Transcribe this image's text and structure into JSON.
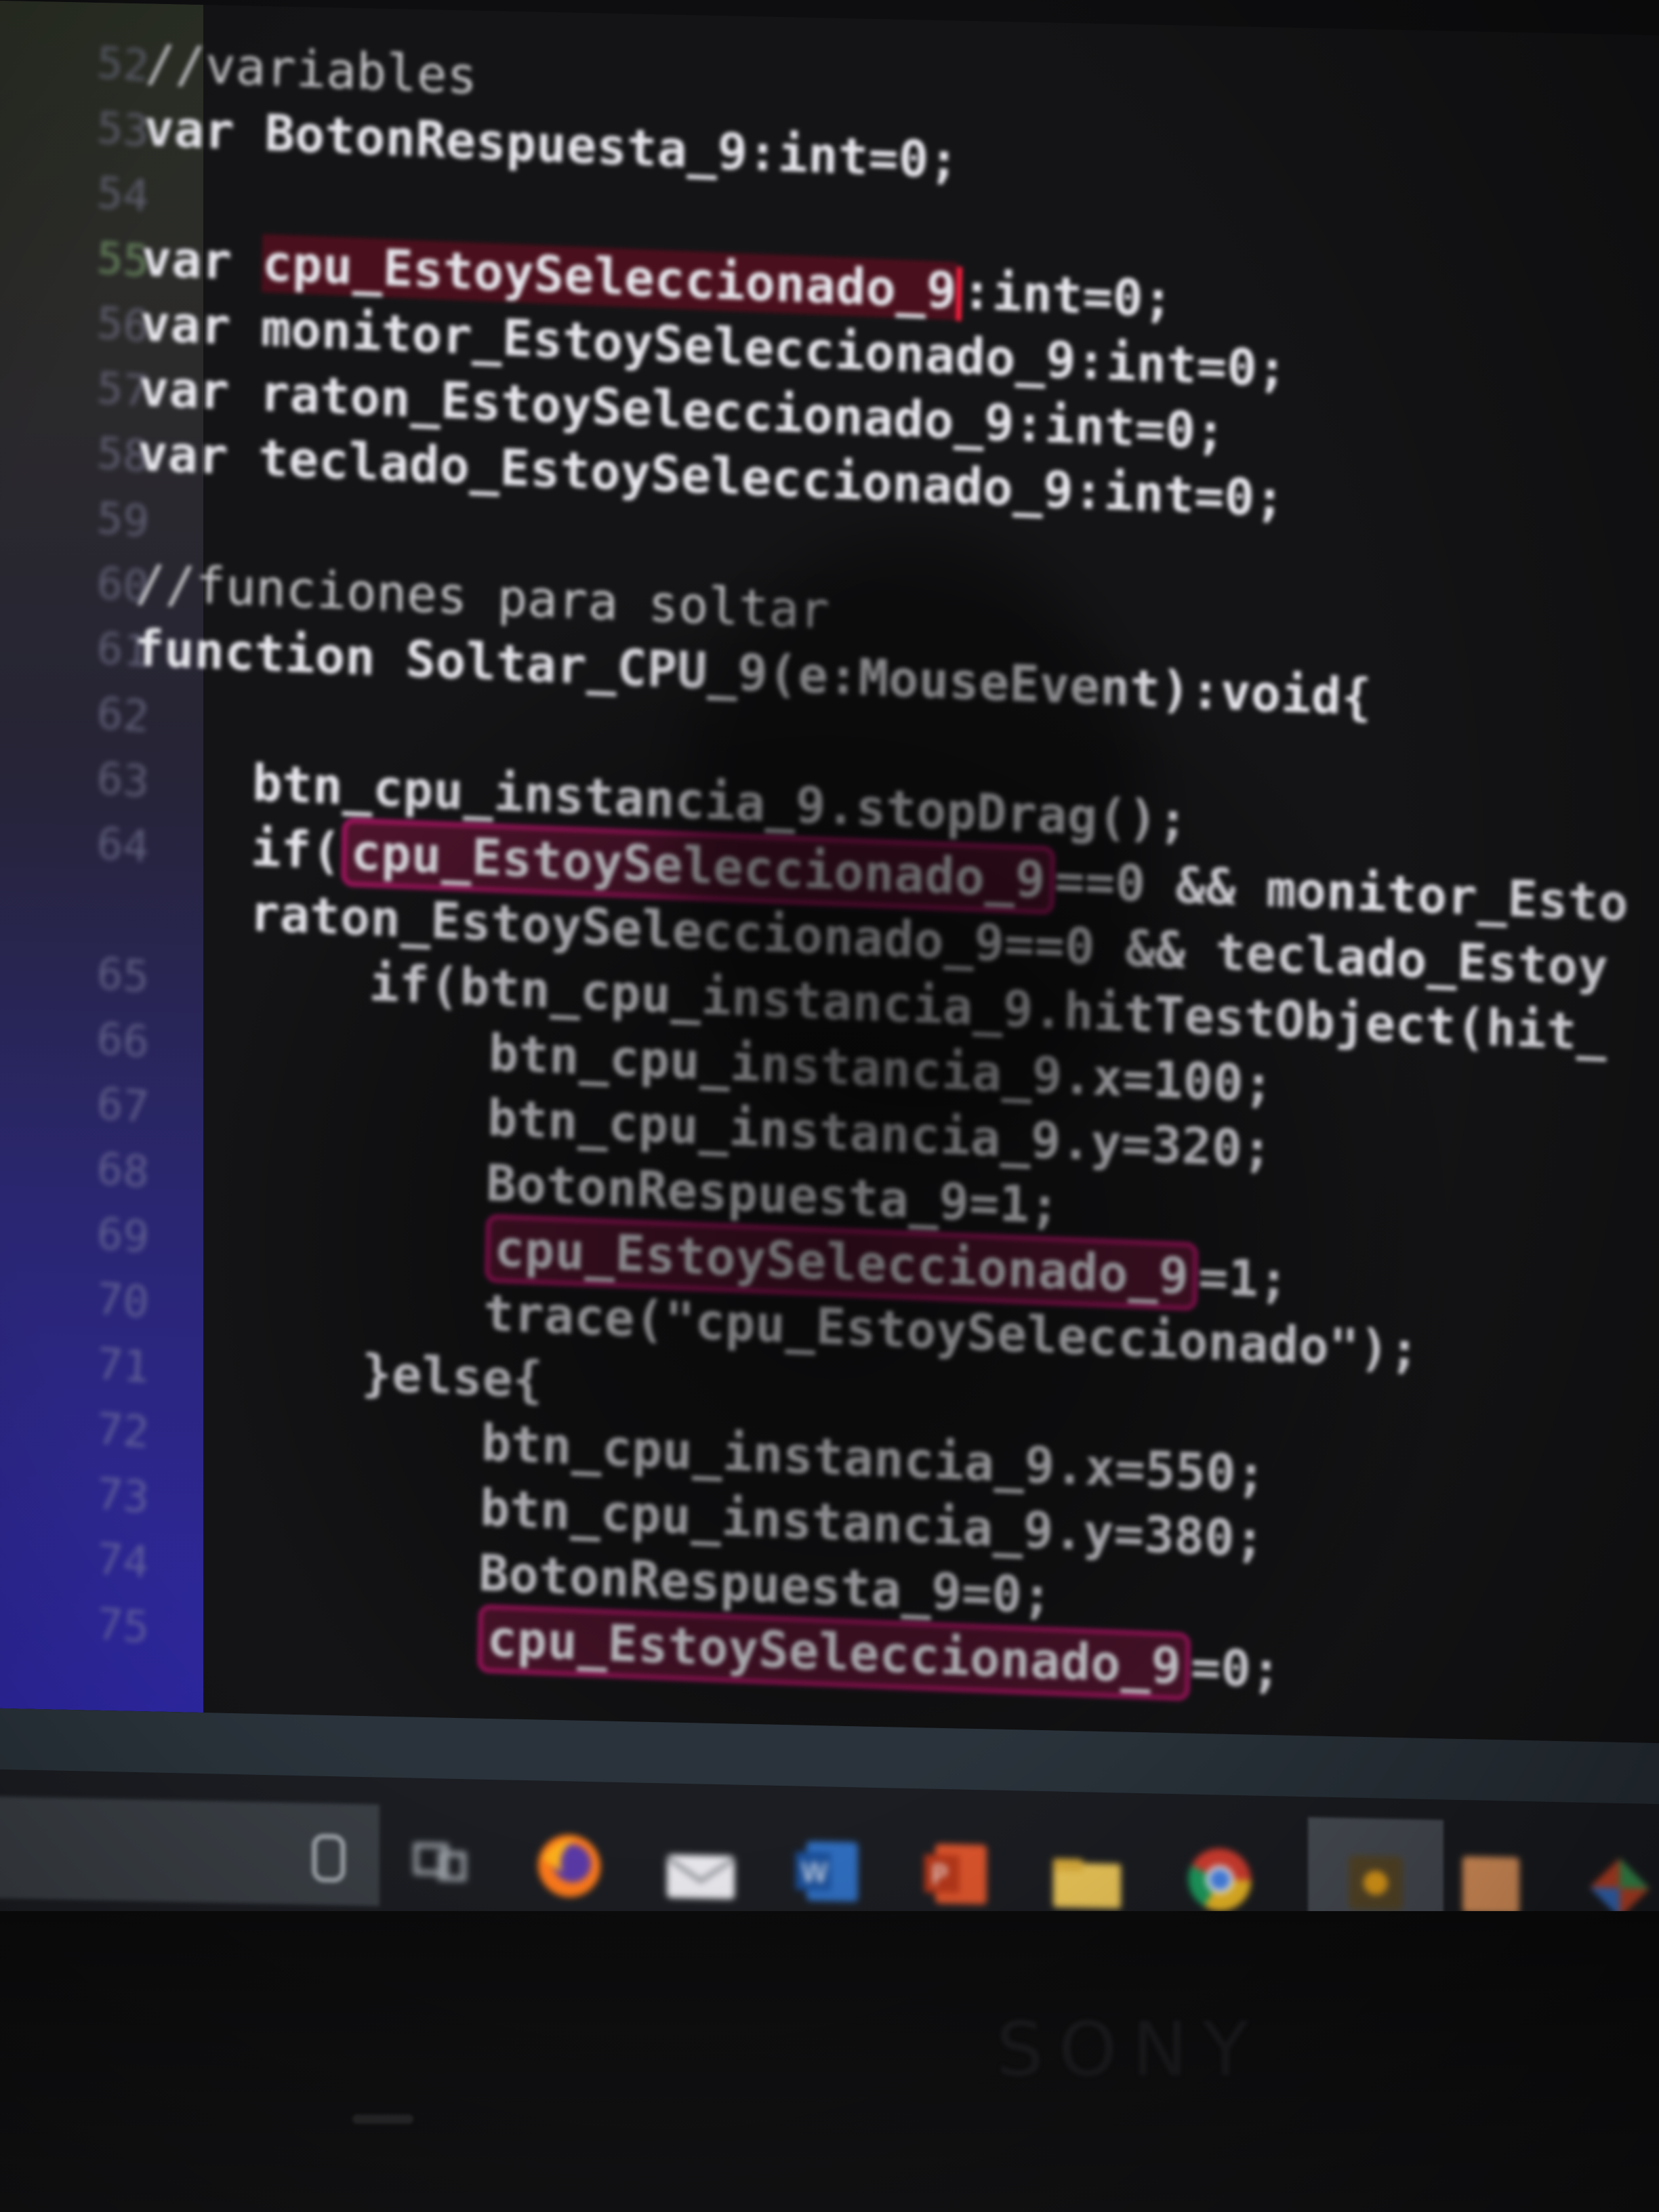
{
  "editor": {
    "line_numbers": [
      "52",
      "53",
      "54",
      "55",
      "56",
      "57",
      "58",
      "59",
      "60",
      "61",
      "62",
      "63",
      "64",
      "",
      "65",
      "66",
      "67",
      "68",
      "69",
      "70",
      "71",
      "72",
      "73",
      "74",
      "75"
    ],
    "current_line": "55",
    "lines": [
      "//variables",
      "var BotonRespuesta_9:int=0;",
      "",
      "var cpu_EstoySeleccionado_9:int=0;",
      "var monitor_EstoySeleccionado_9:int=0;",
      "var raton_EstoySeleccionado_9:int=0;",
      "var teclado_EstoySeleccionado_9:int=0;",
      "",
      "//funciones para soltar",
      "function Soltar_CPU_9(e:MouseEvent):void{",
      "",
      "    btn_cpu_instancia_9.stopDrag();",
      "    if(cpu_EstoySeleccionado_9==0 && monitor_Esto",
      "    raton_EstoySeleccionado_9==0 && teclado_Estoy",
      "        if(btn_cpu_instancia_9.hitTestObject(hit_",
      "            btn_cpu_instancia_9.x=100;",
      "            btn_cpu_instancia_9.y=320;",
      "            BotonRespuesta_9=1;",
      "            cpu_EstoySeleccionado_9=1;",
      "            trace(\"cpu_EstoySeleccionado\");",
      "        }else{",
      "            btn_cpu_instancia_9.x=550;",
      "            btn_cpu_instancia_9.y=380;",
      "            BotonRespuesta_9=0;",
      "            cpu_EstoySeleccionado_9=0;"
    ],
    "highlight_token": "cpu_EstoySeleccionado_9"
  },
  "taskbar": {
    "icons": [
      "cortana-mic-icon",
      "task-view-icon",
      "firefox-icon",
      "mail-icon",
      "word-icon",
      "powerpoint-icon",
      "file-explorer-icon",
      "chrome-icon",
      "animate-icon",
      "app-orange-icon",
      "app-colorful-icon"
    ]
  },
  "bezel": {
    "brand": "SONY"
  },
  "colors": {
    "background": "#141416",
    "code_text": "#e8e8ee",
    "highlight_border": "#a0155e",
    "cursor": "#ff2040",
    "gutter_bottom": "#2d27a2"
  }
}
